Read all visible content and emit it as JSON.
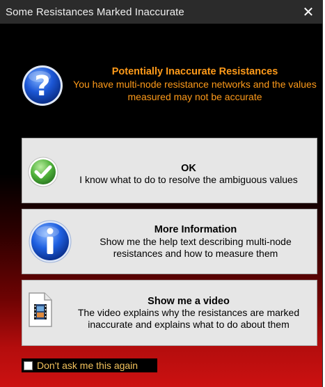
{
  "window": {
    "title": "Some Resistances Marked Inaccurate",
    "close_glyph": "✕"
  },
  "header": {
    "icon": "question-icon",
    "title": "Potentially Inaccurate Resistances",
    "body": "You have multi-node resistance networks and the values measured may not be accurate",
    "color": "#ff9b1a"
  },
  "commands": {
    "ok": {
      "icon": "checkmark-icon",
      "title": "OK",
      "body": "I know what to do to resolve the ambiguous values"
    },
    "more_info": {
      "icon": "info-icon",
      "title": "More Information",
      "body": "Show me the help text describing multi-node resistances and how to measure them"
    },
    "video": {
      "icon": "video-file-icon",
      "title": "Show me a video",
      "body": "The video explains why the resistances are marked inaccurate and explains what to do about them"
    }
  },
  "dont_ask": {
    "label": "Don't ask me this again",
    "checked": false
  }
}
